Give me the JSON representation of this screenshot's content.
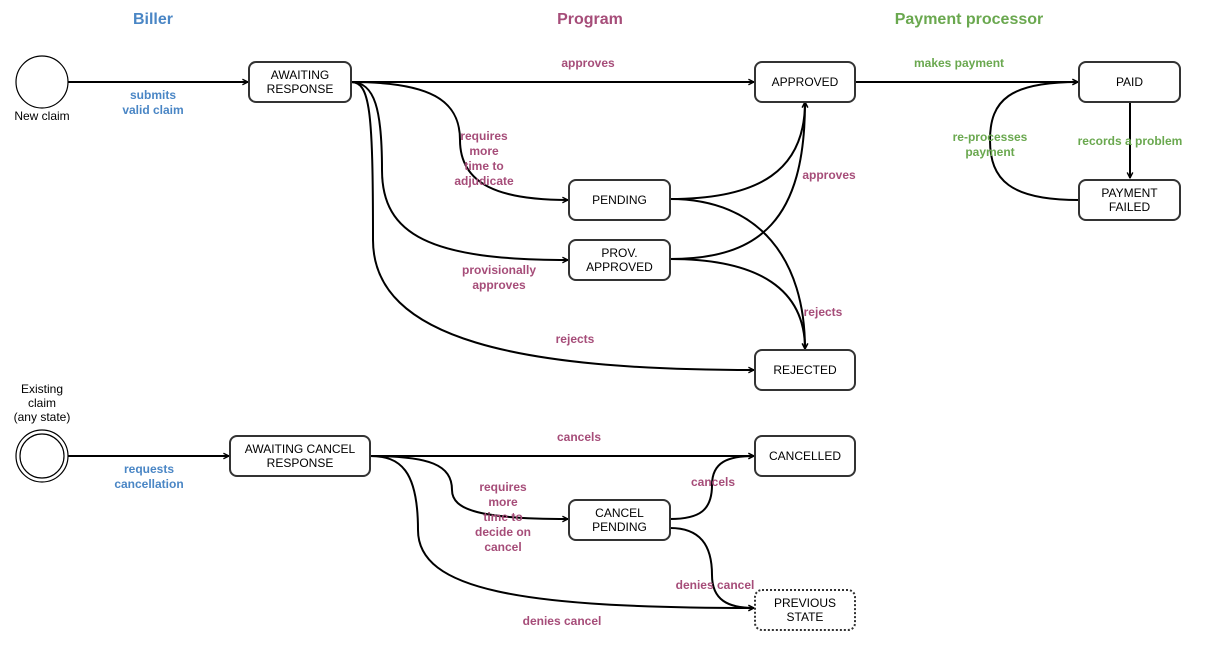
{
  "colors": {
    "biller": "#4a86c5",
    "program": "#a64d79",
    "processor": "#6aa84f",
    "edge": "#000000",
    "node_border": "#333333"
  },
  "lanes": {
    "biller": "Biller",
    "program": "Program",
    "processor": "Payment processor"
  },
  "start_states": {
    "new_claim": "New claim",
    "existing_claim": [
      "Existing",
      "claim",
      "(any state)"
    ]
  },
  "states": {
    "awaiting_response": [
      "AWAITING",
      "RESPONSE"
    ],
    "approved": [
      "APPROVED"
    ],
    "paid": [
      "PAID"
    ],
    "payment_failed": [
      "PAYMENT",
      "FAILED"
    ],
    "pending": [
      "PENDING"
    ],
    "prov_approved": [
      "PROV.",
      "APPROVED"
    ],
    "rejected": [
      "REJECTED"
    ],
    "awaiting_cancel_response": [
      "AWAITING CANCEL",
      "RESPONSE"
    ],
    "cancelled": [
      "CANCELLED"
    ],
    "cancel_pending": [
      "CANCEL",
      "PENDING"
    ],
    "previous_state": [
      "PREVIOUS",
      "STATE"
    ]
  },
  "transitions": {
    "submits_valid_claim": [
      "submits",
      "valid claim"
    ],
    "approves_direct": [
      "approves"
    ],
    "makes_payment": [
      "makes payment"
    ],
    "requires_more_time": [
      "requires",
      "more",
      "time to",
      "adjudicate"
    ],
    "approves_from_pending": [
      "approves"
    ],
    "provisionally_approves": [
      "provisionally",
      "approves"
    ],
    "rejects_from_pending": [
      "rejects"
    ],
    "rejects_direct": [
      "rejects"
    ],
    "re_processes_payment": [
      "re-processes",
      "payment"
    ],
    "records_a_problem": [
      "records a problem"
    ],
    "requests_cancellation": [
      "requests",
      "cancellation"
    ],
    "cancels_direct": [
      "cancels"
    ],
    "requires_more_time_cancel": [
      "requires",
      "more",
      "time to",
      "decide on",
      "cancel"
    ],
    "cancels_from_pending": [
      "cancels"
    ],
    "denies_cancel_from_pending": [
      "denies cancel"
    ],
    "denies_cancel_direct": [
      "denies cancel"
    ]
  }
}
